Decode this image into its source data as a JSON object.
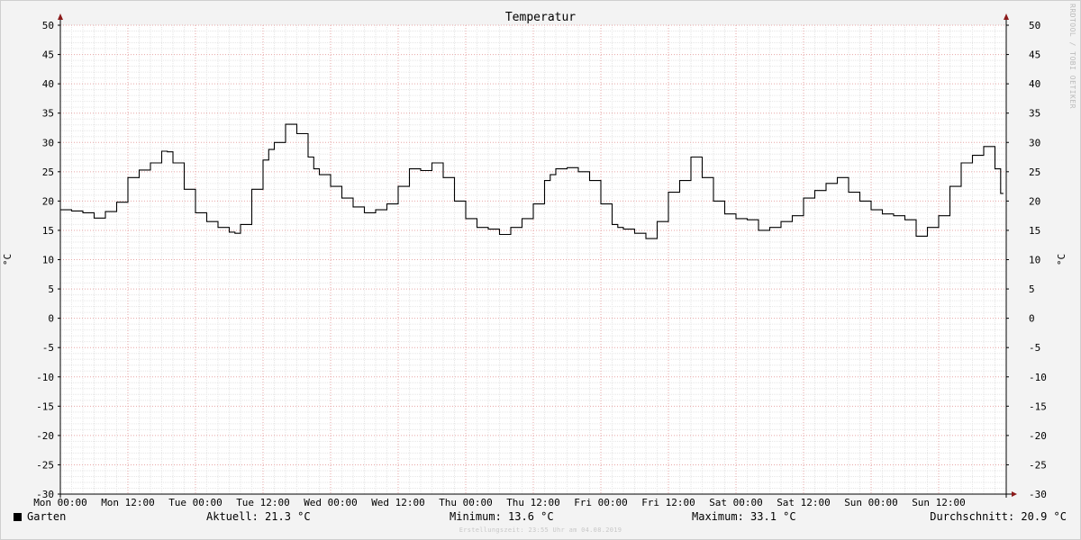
{
  "chart_data": {
    "type": "line",
    "title": "Temperatur",
    "ylabel": "°C",
    "ylabel_right": "°C",
    "ylim": [
      -30,
      50
    ],
    "yticks": [
      50,
      45,
      40,
      35,
      30,
      25,
      20,
      15,
      10,
      5,
      0,
      -5,
      -10,
      -15,
      -20,
      -25,
      -30
    ],
    "xlim_hours": [
      0,
      168
    ],
    "xtick_labels": [
      "Mon 00:00",
      "Mon 12:00",
      "Tue 00:00",
      "Tue 12:00",
      "Wed 00:00",
      "Wed 12:00",
      "Thu 00:00",
      "Thu 12:00",
      "Fri 00:00",
      "Fri 12:00",
      "Sat 00:00",
      "Sat 12:00",
      "Sun 00:00",
      "Sun 12:00"
    ],
    "grid": true,
    "series": [
      {
        "name": "Garten",
        "color": "#000000",
        "x_hours": [
          0,
          2,
          4,
          6,
          8,
          10,
          12,
          14,
          16,
          18,
          19,
          20,
          22,
          24,
          26,
          28,
          30,
          31,
          32,
          34,
          36,
          37,
          38,
          40,
          42,
          44,
          45,
          46,
          48,
          50,
          52,
          54,
          56,
          58,
          60,
          62,
          64,
          66,
          68,
          70,
          72,
          74,
          76,
          78,
          80,
          82,
          84,
          86,
          87,
          88,
          90,
          92,
          94,
          96,
          98,
          99,
          100,
          102,
          104,
          106,
          108,
          110,
          112,
          114,
          116,
          118,
          120,
          122,
          124,
          126,
          128,
          130,
          132,
          134,
          136,
          138,
          140,
          142,
          144,
          146,
          148,
          150,
          152,
          154,
          156,
          158,
          160,
          162,
          164,
          166,
          167
        ],
        "values": [
          18.5,
          18.3,
          18.0,
          17.1,
          18.2,
          19.8,
          24.0,
          25.3,
          26.5,
          28.5,
          28.4,
          26.5,
          22.0,
          18.0,
          16.5,
          15.5,
          14.7,
          14.5,
          16.0,
          22.0,
          27.0,
          28.8,
          30.0,
          33.1,
          31.5,
          27.5,
          25.5,
          24.5,
          22.5,
          20.5,
          19.0,
          18.0,
          18.5,
          19.5,
          22.5,
          25.5,
          25.2,
          26.5,
          24.0,
          20.0,
          17.0,
          15.5,
          15.2,
          14.3,
          15.5,
          17.0,
          19.5,
          23.5,
          24.5,
          25.5,
          25.7,
          25.0,
          23.5,
          19.5,
          16.0,
          15.5,
          15.2,
          14.5,
          13.6,
          16.5,
          21.5,
          23.5,
          27.5,
          24.0,
          20.0,
          17.8,
          17.0,
          16.8,
          15.0,
          15.5,
          16.5,
          17.5,
          20.5,
          21.8,
          23.0,
          24.0,
          21.5,
          20.0,
          18.5,
          17.8,
          17.5,
          16.8,
          14.0,
          15.5,
          17.5,
          22.5,
          26.5,
          27.8,
          29.3,
          25.5,
          21.3
        ]
      }
    ]
  },
  "legend": {
    "name": "Garten",
    "current": "Aktuell: 21.3 °C",
    "minimum": "Minimum: 13.6 °C",
    "maximum": "Maximum: 33.1 °C",
    "average": "Durchschnitt: 20.9 °C"
  },
  "footer": "Erstellungszeit: 23:55 Uhr am 04.08.2019",
  "watermark": "RRDTOOL / TOBI OETIKER"
}
